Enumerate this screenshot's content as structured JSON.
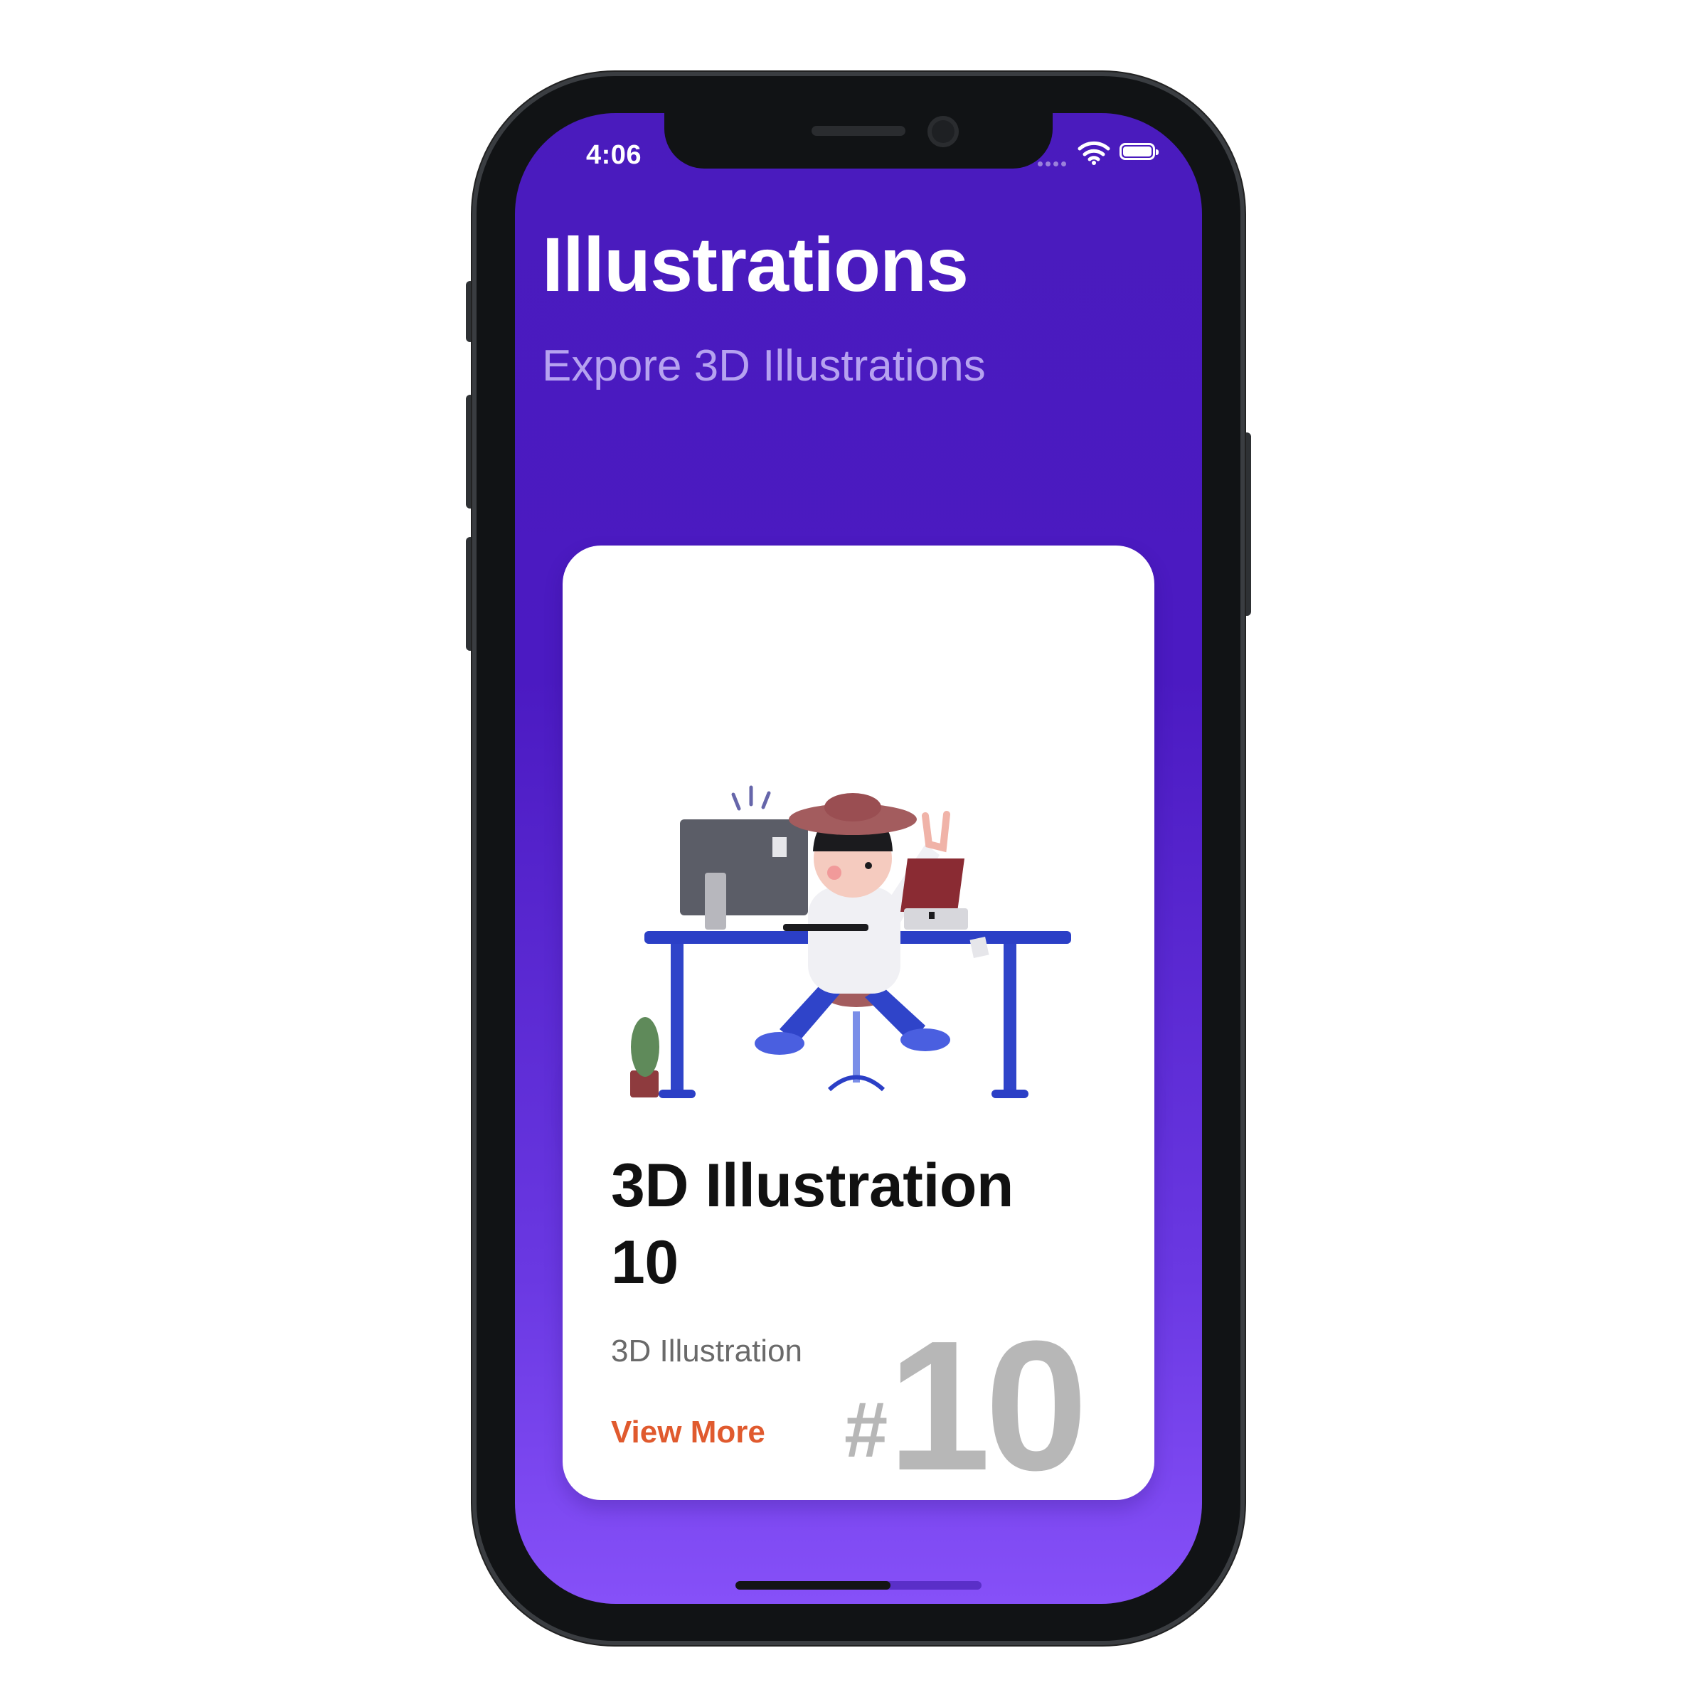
{
  "status_bar": {
    "time": "4:06",
    "wifi_icon": "wifi-icon",
    "battery_icon": "battery-icon",
    "signal_icon": "cellular-signal-icon"
  },
  "header": {
    "title": "Illustrations",
    "subtitle": "Expore 3D Illustrations"
  },
  "card": {
    "title": "3D Illustration 10",
    "subtitle": "3D Illustration",
    "link_label": "View More",
    "number_prefix": "#",
    "number": "10"
  },
  "colors": {
    "background_top": "#4a1bbd",
    "background_bottom": "#8650f8",
    "link": "#e05a2e",
    "number": "#b7b7b7",
    "subtitle": "#b6a2f0"
  }
}
